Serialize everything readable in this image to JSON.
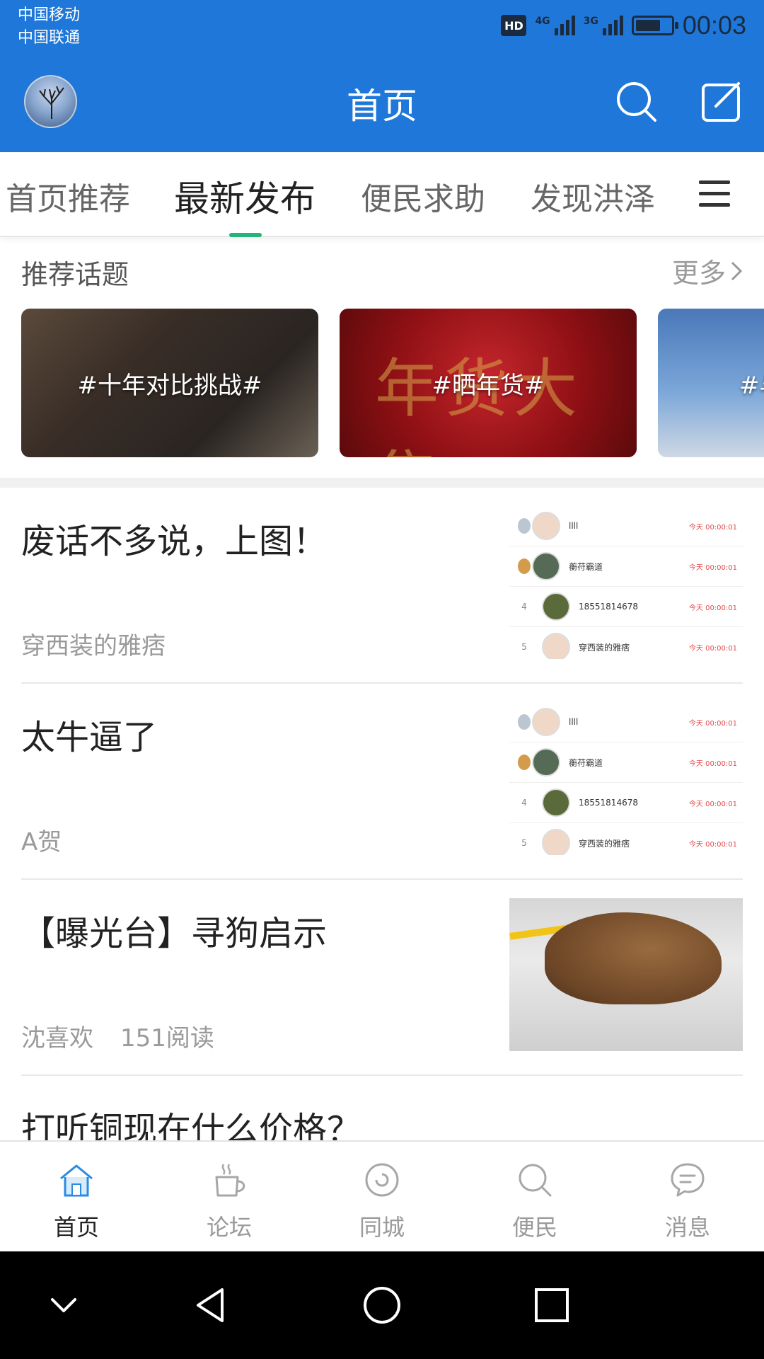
{
  "status_bar": {
    "carrier_1": "中国移动",
    "carrier_2": "中国联通",
    "hd": "HD",
    "net_1": "4G",
    "net_2": "3G",
    "time": "00:03"
  },
  "header": {
    "title": "首页",
    "accent_color": "#1f78d9"
  },
  "tabs": [
    {
      "label": "首页推荐"
    },
    {
      "label": "最新发布"
    },
    {
      "label": "便民求助"
    },
    {
      "label": "发现洪泽"
    }
  ],
  "topics": {
    "title": "推荐话题",
    "more_label": "更多",
    "cards": [
      {
        "label": "#十年对比挑战#"
      },
      {
        "label": "#晒年货#"
      },
      {
        "label": "#与"
      }
    ],
    "card2_art": "年货大集"
  },
  "feed": [
    {
      "title": "废话不多说，上图！",
      "author": "穿西装的雅痞",
      "reads": "",
      "thumb_type": "ranking",
      "ranking": [
        {
          "rank": "2",
          "name": "llll",
          "time": "今天 00:00:01"
        },
        {
          "rank": "3",
          "name": "蘅苻霸道",
          "time": "今天 00:00:01"
        },
        {
          "rank": "4",
          "name": "18551814678",
          "time": "今天 00:00:01"
        },
        {
          "rank": "5",
          "name": "穿西装的雅痞",
          "time": "今天 00:00:01"
        }
      ]
    },
    {
      "title": "太牛逼了",
      "author": "A贺",
      "reads": "",
      "thumb_type": "ranking",
      "ranking": [
        {
          "rank": "2",
          "name": "llll",
          "time": "今天 00:00:01"
        },
        {
          "rank": "3",
          "name": "蘅苻霸道",
          "time": "今天 00:00:01"
        },
        {
          "rank": "4",
          "name": "18551814678",
          "time": "今天 00:00:01"
        },
        {
          "rank": "5",
          "name": "穿西装的雅痞",
          "time": "今天 00:00:01"
        }
      ]
    },
    {
      "title": "【曝光台】寻狗启示",
      "author": "沈喜欢",
      "reads": "151阅读",
      "thumb_type": "photo"
    },
    {
      "title": "打听铜现在什么价格？",
      "author": "",
      "reads": ""
    }
  ],
  "bottom_nav": [
    {
      "label": "首页",
      "icon": "home-icon",
      "active": true
    },
    {
      "label": "论坛",
      "icon": "coffee-cup-icon",
      "active": false
    },
    {
      "label": "同城",
      "icon": "circle-refresh-icon",
      "active": false
    },
    {
      "label": "便民",
      "icon": "search-icon",
      "active": false
    },
    {
      "label": "消息",
      "icon": "chat-bubble-icon",
      "active": false
    }
  ]
}
